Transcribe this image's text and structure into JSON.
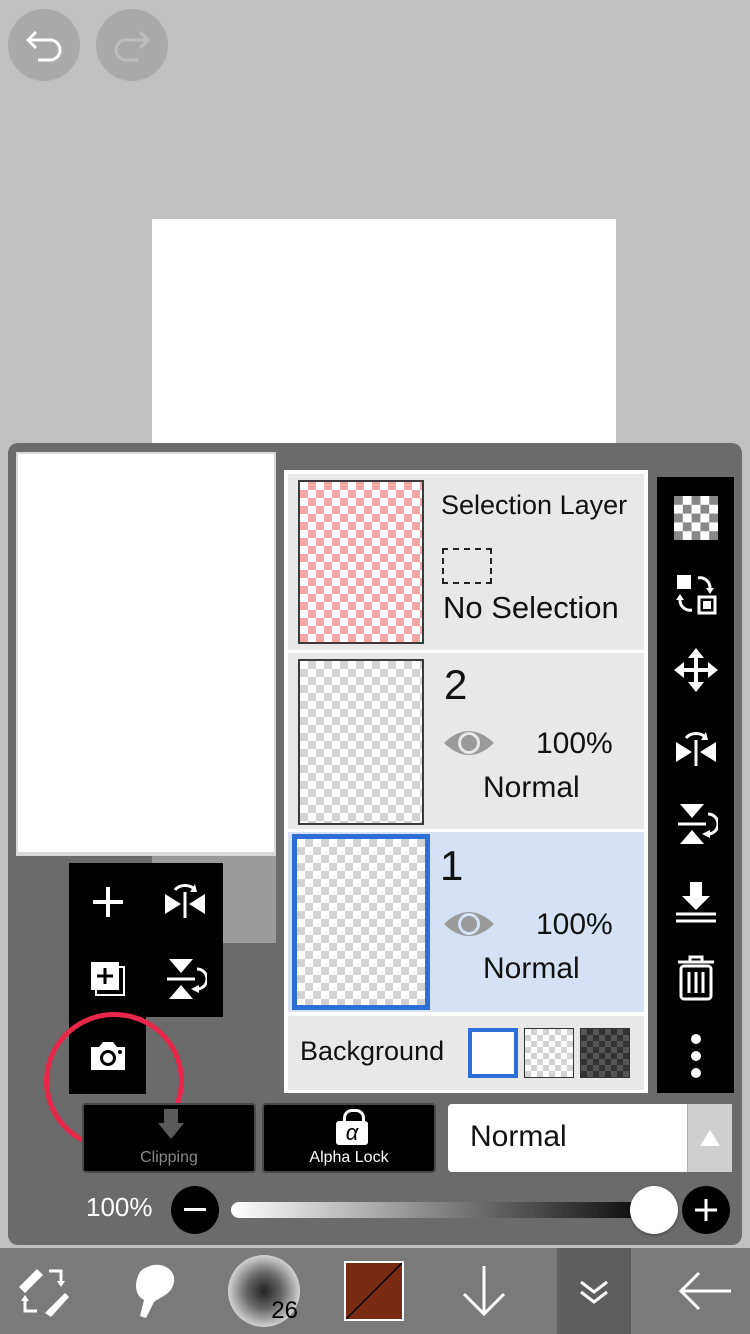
{
  "layers_panel": {
    "selection_layer": {
      "title": "Selection Layer",
      "status": "No Selection"
    },
    "layers": [
      {
        "name": "2",
        "opacity": "100%",
        "blend_mode": "Normal",
        "visible": true,
        "selected": false
      },
      {
        "name": "1",
        "opacity": "100%",
        "blend_mode": "Normal",
        "visible": true,
        "selected": true
      }
    ],
    "background": {
      "label": "Background",
      "options": [
        "white",
        "transparent",
        "dark"
      ],
      "selected": "white"
    }
  },
  "controls": {
    "clipping_label": "Clipping",
    "alpha_lock_label": "Alpha Lock",
    "alpha_icon": "α",
    "blend_mode": "Normal",
    "opacity_label": "100%",
    "opacity_value": 1.0
  },
  "bottom_bar": {
    "brush_size": "26",
    "current_color": "#7a2b14"
  },
  "colors": {
    "accent": "#2d6fd6",
    "annotation": "#e8274b"
  }
}
